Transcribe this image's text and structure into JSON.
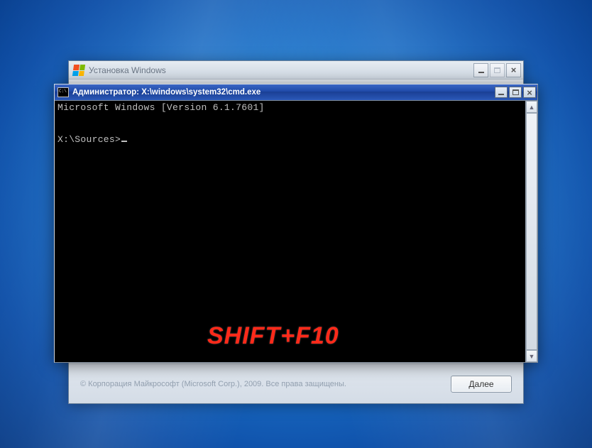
{
  "installer": {
    "title": "Установка Windows",
    "copyright": "© Корпорация Майкрософт (Microsoft Corp.), 2009. Все права защищены.",
    "next_label": "Далее"
  },
  "cmd": {
    "title": "Администратор: X:\\windows\\system32\\cmd.exe",
    "version_line": "Microsoft Windows [Version 6.1.7601]",
    "prompt": "X:\\Sources>"
  },
  "annotation": {
    "text": "SHIFT+F10"
  }
}
